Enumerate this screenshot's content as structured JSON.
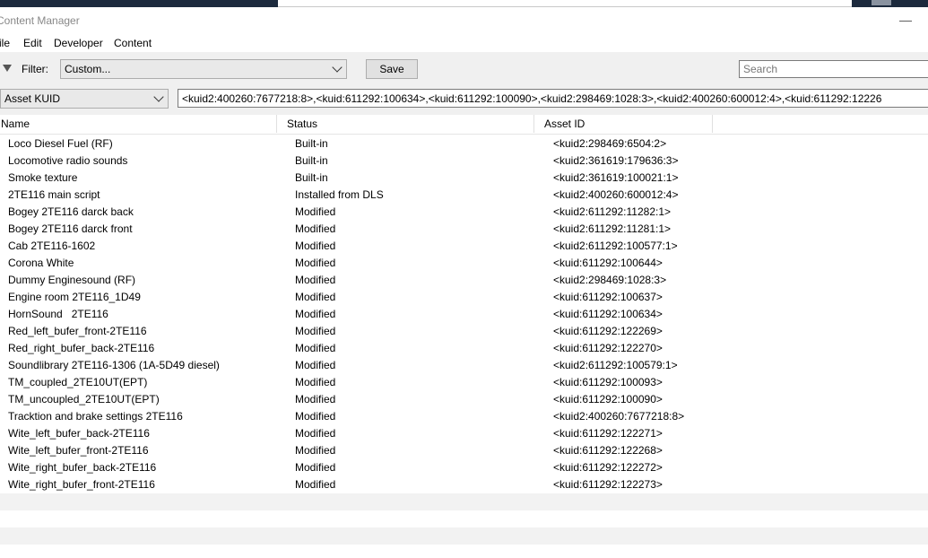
{
  "window": {
    "title": "Content Manager",
    "minimize_symbol": "—"
  },
  "menu": [
    "ile",
    "Edit",
    "Developer",
    "Content"
  ],
  "toolbar": {
    "filter_label": "Filter:",
    "filter_value": "Custom...",
    "save_label": "Save",
    "search_placeholder": "Search",
    "field_select": "Asset KUID",
    "kuid_list": "<kuid2:400260:7677218:8>,<kuid:611292:100634>,<kuid:611292:100090>,<kuid2:298469:1028:3>,<kuid2:400260:600012:4>,<kuid:611292:12226"
  },
  "columns": {
    "name": "Name",
    "status": "Status",
    "asset_id": "Asset ID"
  },
  "rows": [
    {
      "name": "Loco Diesel Fuel (RF)",
      "status": "Built-in",
      "id": "<kuid2:298469:6504:2>"
    },
    {
      "name": "Locomotive radio sounds",
      "status": "Built-in",
      "id": "<kuid2:361619:179636:3>"
    },
    {
      "name": "Smoke texture",
      "status": "Built-in",
      "id": "<kuid2:361619:100021:1>"
    },
    {
      "name": "2TE116 main script",
      "status": "Installed from DLS",
      "id": "<kuid2:400260:600012:4>"
    },
    {
      "name": "Bogey 2TE116 darck back",
      "status": "Modified",
      "id": "<kuid2:611292:11282:1>"
    },
    {
      "name": "Bogey 2TE116 darck front",
      "status": "Modified",
      "id": "<kuid2:611292:11281:1>"
    },
    {
      "name": "Cab 2TE116-1602",
      "status": "Modified",
      "id": "<kuid2:611292:100577:1>"
    },
    {
      "name": "Corona White",
      "status": "Modified",
      "id": "<kuid:611292:100644>"
    },
    {
      "name": "Dummy Enginesound (RF)",
      "status": "Modified",
      "id": "<kuid2:298469:1028:3>"
    },
    {
      "name": "Engine room 2TE116_1D49",
      "status": "Modified",
      "id": "<kuid:611292:100637>"
    },
    {
      "name": "HornSound   2TE116",
      "status": "Modified",
      "id": "<kuid:611292:100634>"
    },
    {
      "name": "Red_left_bufer_front-2TE116",
      "status": "Modified",
      "id": "<kuid:611292:122269>"
    },
    {
      "name": "Red_right_bufer_back-2TE116",
      "status": "Modified",
      "id": "<kuid:611292:122270>"
    },
    {
      "name": "Soundlibrary 2TE116-1306 (1A-5D49 diesel)",
      "status": "Modified",
      "id": "<kuid2:611292:100579:1>"
    },
    {
      "name": "TM_coupled_2TE10UT(EPT)",
      "status": "Modified",
      "id": "<kuid:611292:100093>"
    },
    {
      "name": "TM_uncoupled_2TE10UT(EPT)",
      "status": "Modified",
      "id": "<kuid:611292:100090>"
    },
    {
      "name": "Tracktion and brake settings 2TE116",
      "status": "Modified",
      "id": "<kuid2:400260:7677218:8>"
    },
    {
      "name": "Wite_left_bufer_back-2TE116",
      "status": "Modified",
      "id": "<kuid:611292:122271>"
    },
    {
      "name": "Wite_left_bufer_front-2TE116",
      "status": "Modified",
      "id": "<kuid:611292:122268>"
    },
    {
      "name": "Wite_right_bufer_back-2TE116",
      "status": "Modified",
      "id": "<kuid:611292:122272>"
    },
    {
      "name": "Wite_right_bufer_front-2TE116",
      "status": "Modified",
      "id": "<kuid:611292:122273>"
    }
  ]
}
